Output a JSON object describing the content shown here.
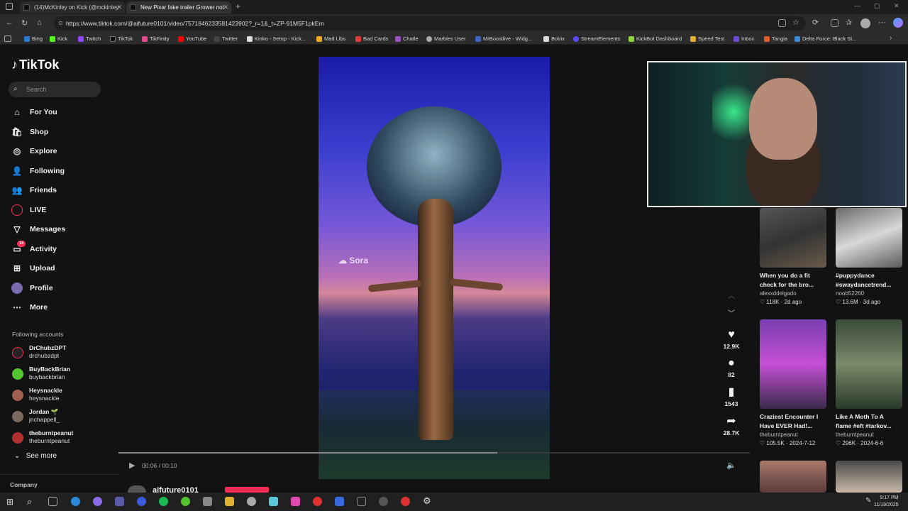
{
  "browser": {
    "tabs": [
      {
        "title": "(14)McKinley on Kick (@mckinley"
      },
      {
        "title": "New Pixar fake trailer Grower not"
      }
    ],
    "new_tab": "+",
    "url": "https://www.tiktok.com/@aifuture0101/video/7571846233581423902?_r=1&_t=ZP-91M5F1pkErn",
    "bookmarks": [
      "Bing",
      "Kick",
      "Twitch",
      "TikTok",
      "TikFinity",
      "YouTube",
      "Twitter",
      "Kinko - Setup - Kick...",
      "Mad Libs",
      "Bad Cards",
      "Chatle",
      "Marbles User",
      "MrBoostlive - Widg...",
      "Botrix",
      "StreamElements",
      "KickBot Dashboard",
      "Speed Test",
      "Inbox",
      "Tangia",
      "Delta Force: Black Si..."
    ]
  },
  "tiktok": {
    "logo": "TikTok",
    "search_placeholder": "Search",
    "nav": [
      {
        "label": "For You",
        "icon": "home-icon"
      },
      {
        "label": "Shop",
        "icon": "shop-icon"
      },
      {
        "label": "Explore",
        "icon": "explore-icon"
      },
      {
        "label": "Following",
        "icon": "following-icon"
      },
      {
        "label": "Friends",
        "icon": "friends-icon"
      },
      {
        "label": "LIVE",
        "icon": "live-icon"
      },
      {
        "label": "Messages",
        "icon": "messages-icon"
      },
      {
        "label": "Activity",
        "icon": "activity-icon",
        "badge": "14"
      },
      {
        "label": "Upload",
        "icon": "upload-icon"
      },
      {
        "label": "Profile",
        "icon": "profile-icon"
      },
      {
        "label": "More",
        "icon": "more-icon"
      }
    ],
    "following_header": "Following accounts",
    "accounts": [
      {
        "name": "DrChubzDPT",
        "handle": "drchubzdpt"
      },
      {
        "name": "BuyBackBrian",
        "handle": "buybackbrian"
      },
      {
        "name": "Heysnackle",
        "handle": "heysnackle"
      },
      {
        "name": "Jordan 🌱",
        "handle": "jnchappell_"
      },
      {
        "name": "theburntpeanut",
        "handle": "theburntpeanut"
      }
    ],
    "see_more": "See more",
    "company": "Company",
    "video": {
      "watermark": "Sora",
      "time": "00:06 / 00:10",
      "progress": 0.6,
      "author": "aifuture0101"
    },
    "actions": [
      {
        "icon": "heart-icon",
        "count": "12.9K"
      },
      {
        "icon": "comment-icon",
        "count": "82"
      },
      {
        "icon": "bookmark-icon",
        "count": "1543"
      },
      {
        "icon": "share-icon",
        "count": "28.7K"
      }
    ],
    "related": [
      {
        "title": "When you do a fit",
        "title2": "check for the bro...",
        "user": "alexxddelgado",
        "stats": "118K · 2d ago"
      },
      {
        "title": "#puppydance",
        "title2": "#swaydancetrend...",
        "user": "noob52260",
        "stats": "13.6M · 3d ago"
      },
      {
        "title": "Craziest Encounter I",
        "title2": "Have EVER Had!...",
        "user": "theburntpeanut",
        "stats": "105.5K · 2024-7-12"
      },
      {
        "title": "Like A Moth To A",
        "title2": "flame #eft #tarkov...",
        "user": "theburntpeanut",
        "stats": "296K · 2024-6-6"
      }
    ]
  },
  "taskbar": {
    "time": "9:17 PM",
    "date": "11/19/2025"
  },
  "colors": {
    "accent": "#fe2c55",
    "bg": "#121212"
  }
}
